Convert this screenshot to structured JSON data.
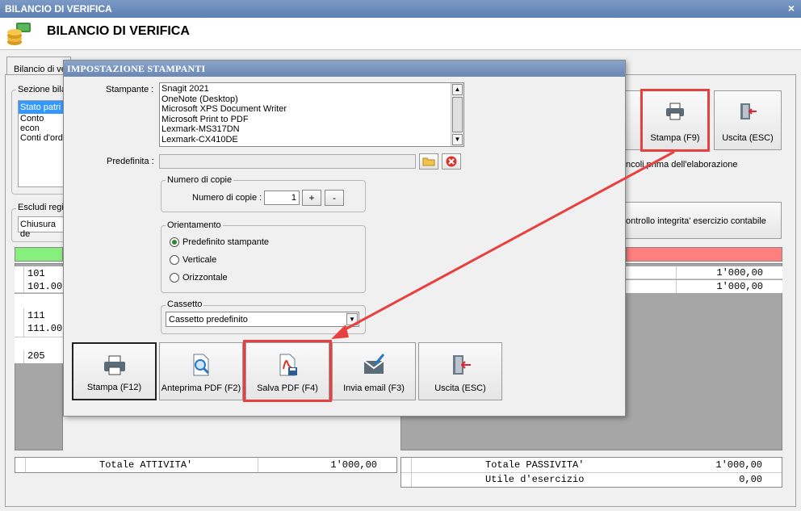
{
  "window": {
    "title": "BILANCIO DI VERIFICA",
    "close_glyph": "×"
  },
  "header": {
    "title": "BILANCIO DI VERIFICA",
    "logo_icon": "coins-icon"
  },
  "background": {
    "tab_label": "Bilancio di ve",
    "sezione_label": "Sezione bila",
    "sezione_items": [
      "Stato patri",
      "Conto econ",
      "Conti d'ord"
    ],
    "escludi_label": "Escludi regis",
    "escludi_value": "Chiusura de",
    "right_note_1": "ncoli prima dell'elaborazione",
    "right_note_2": "ontrollo integrita' esercizio contabile",
    "buttons": {
      "stampa": "Stampa (F9)",
      "uscita": "Uscita (ESC)"
    },
    "left_rows": [
      "101",
      "101.000",
      "111",
      "111.000",
      "205"
    ],
    "right_rows": [
      "1'000,00",
      "1'000,00"
    ],
    "totals_left": {
      "label": "Totale ATTIVITA'",
      "value": "1'000,00"
    },
    "totals_right": [
      {
        "label": "Totale PASSIVITA'",
        "value": "1'000,00"
      },
      {
        "label": "Utile d'esercizio",
        "value": "0,00"
      }
    ],
    "colors": {
      "green": "#86ef7e",
      "red": "#ff7f7f",
      "grey_panel": "#a6a6a6"
    }
  },
  "dialog": {
    "title": "IMPOSTAZIONE STAMPANTI",
    "stampante_label": "Stampante :",
    "printers": [
      "Snagit 2021",
      "OneNote (Desktop)",
      "Microsoft XPS Document Writer",
      "Microsoft Print to PDF",
      "Lexmark-MS317DN",
      "Lexmark-CX410DE"
    ],
    "predefinita_label": "Predefinita :",
    "predefinita_value": "",
    "copie_group": "Numero di copie",
    "copie_label": "Numero di copie :",
    "copie_value": "1",
    "plus": "+",
    "minus": "-",
    "orient_group": "Orientamento",
    "orient_options": [
      "Predefinito stampante",
      "Verticale",
      "Orizzontale"
    ],
    "orient_selected": 0,
    "cassetto_group": "Cassetto",
    "cassetto_value": "Cassetto predefinito",
    "buttons": [
      "Stampa (F12)",
      "Anteprima PDF (F2)",
      "Salva PDF (F4)",
      "Invia email (F3)",
      "Uscita (ESC)"
    ]
  },
  "annotation_color": "#e8403f"
}
